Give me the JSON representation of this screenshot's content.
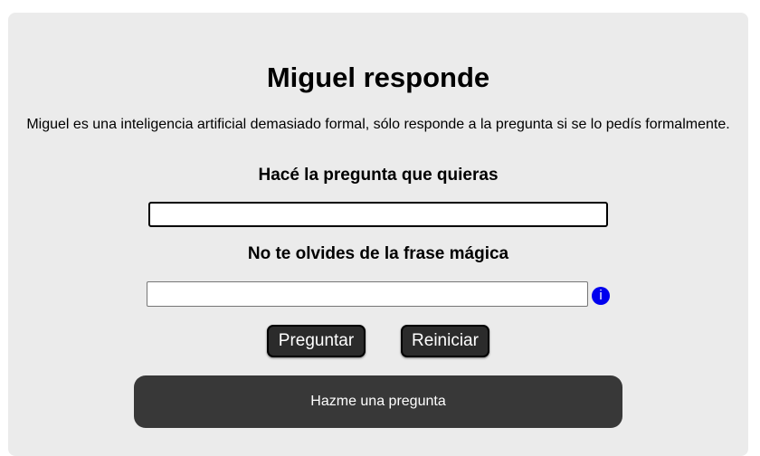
{
  "page": {
    "title": "Miguel responde",
    "description": "Miguel es una inteligencia artificial demasiado formal, sólo responde a la pregunta si se lo pedís formalmente."
  },
  "form": {
    "question_label": "Hacé la pregunta que quieras",
    "question_value": "",
    "magic_label": "No te olvides de la frase mágica",
    "magic_value": "",
    "info_icon": "info-icon",
    "info_glyph": "i",
    "ask_button": "Preguntar",
    "reset_button": "Reiniciar"
  },
  "answer": {
    "text": "Hazme una pregunta"
  },
  "colors": {
    "card_bg": "#ebebeb",
    "button_bg": "#2b2b2b",
    "answer_bg": "#383838",
    "info_blue": "#0000ee"
  }
}
